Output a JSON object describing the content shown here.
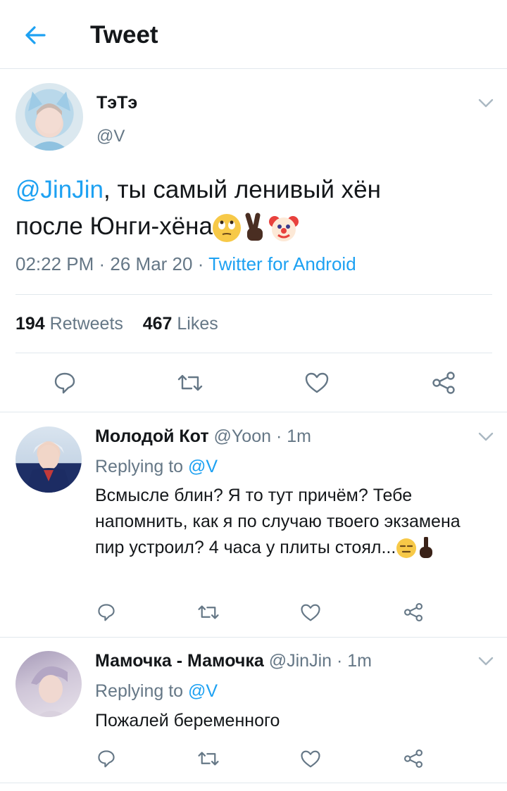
{
  "header": {
    "title": "Tweet",
    "back_icon": "arrow-left-icon",
    "accent": "#1da1f2"
  },
  "tweet": {
    "author_name": "ТэТэ",
    "author_handle": "@V",
    "text_mention": "@JinJin",
    "text_body_1": ", ты самый ленивый хён",
    "text_body_2": "после Юнги-хёна",
    "emojis": [
      "face-with-rolling-eyes-icon",
      "victory-hand-icon",
      "clown-face-icon"
    ],
    "time": "02:22 PM",
    "date": "26 Mar 20",
    "source": "Twitter for Android",
    "retweets_count": "194",
    "retweets_label": "Retweets",
    "likes_count": "467",
    "likes_label": "Likes"
  },
  "replies": [
    {
      "author_name": "Молодой Кот",
      "author_handle": "@Yoon",
      "time_ago": "1m",
      "replying_label": "Replying to",
      "replying_to": "@V",
      "text": "Всмысле блин? Я то тут причём? Тебе напомнить, как я по случаю твоего экзамена пир устроил? 4 часа у плиты стоял...",
      "emojis": [
        "expressionless-face-icon",
        "index-pointing-up-icon"
      ]
    },
    {
      "author_name": "Мамочка - Мамочка",
      "author_handle": "@JinJin",
      "time_ago": "1m",
      "replying_label": "Replying to",
      "replying_to": "@V",
      "text": "Пожалей беременного"
    }
  ],
  "actions": [
    "reply-icon",
    "retweet-icon",
    "like-icon",
    "share-icon"
  ],
  "colors": {
    "text": "#14171a",
    "secondary": "#657786",
    "link": "#1da1f2",
    "divider": "#e1e8ed"
  }
}
